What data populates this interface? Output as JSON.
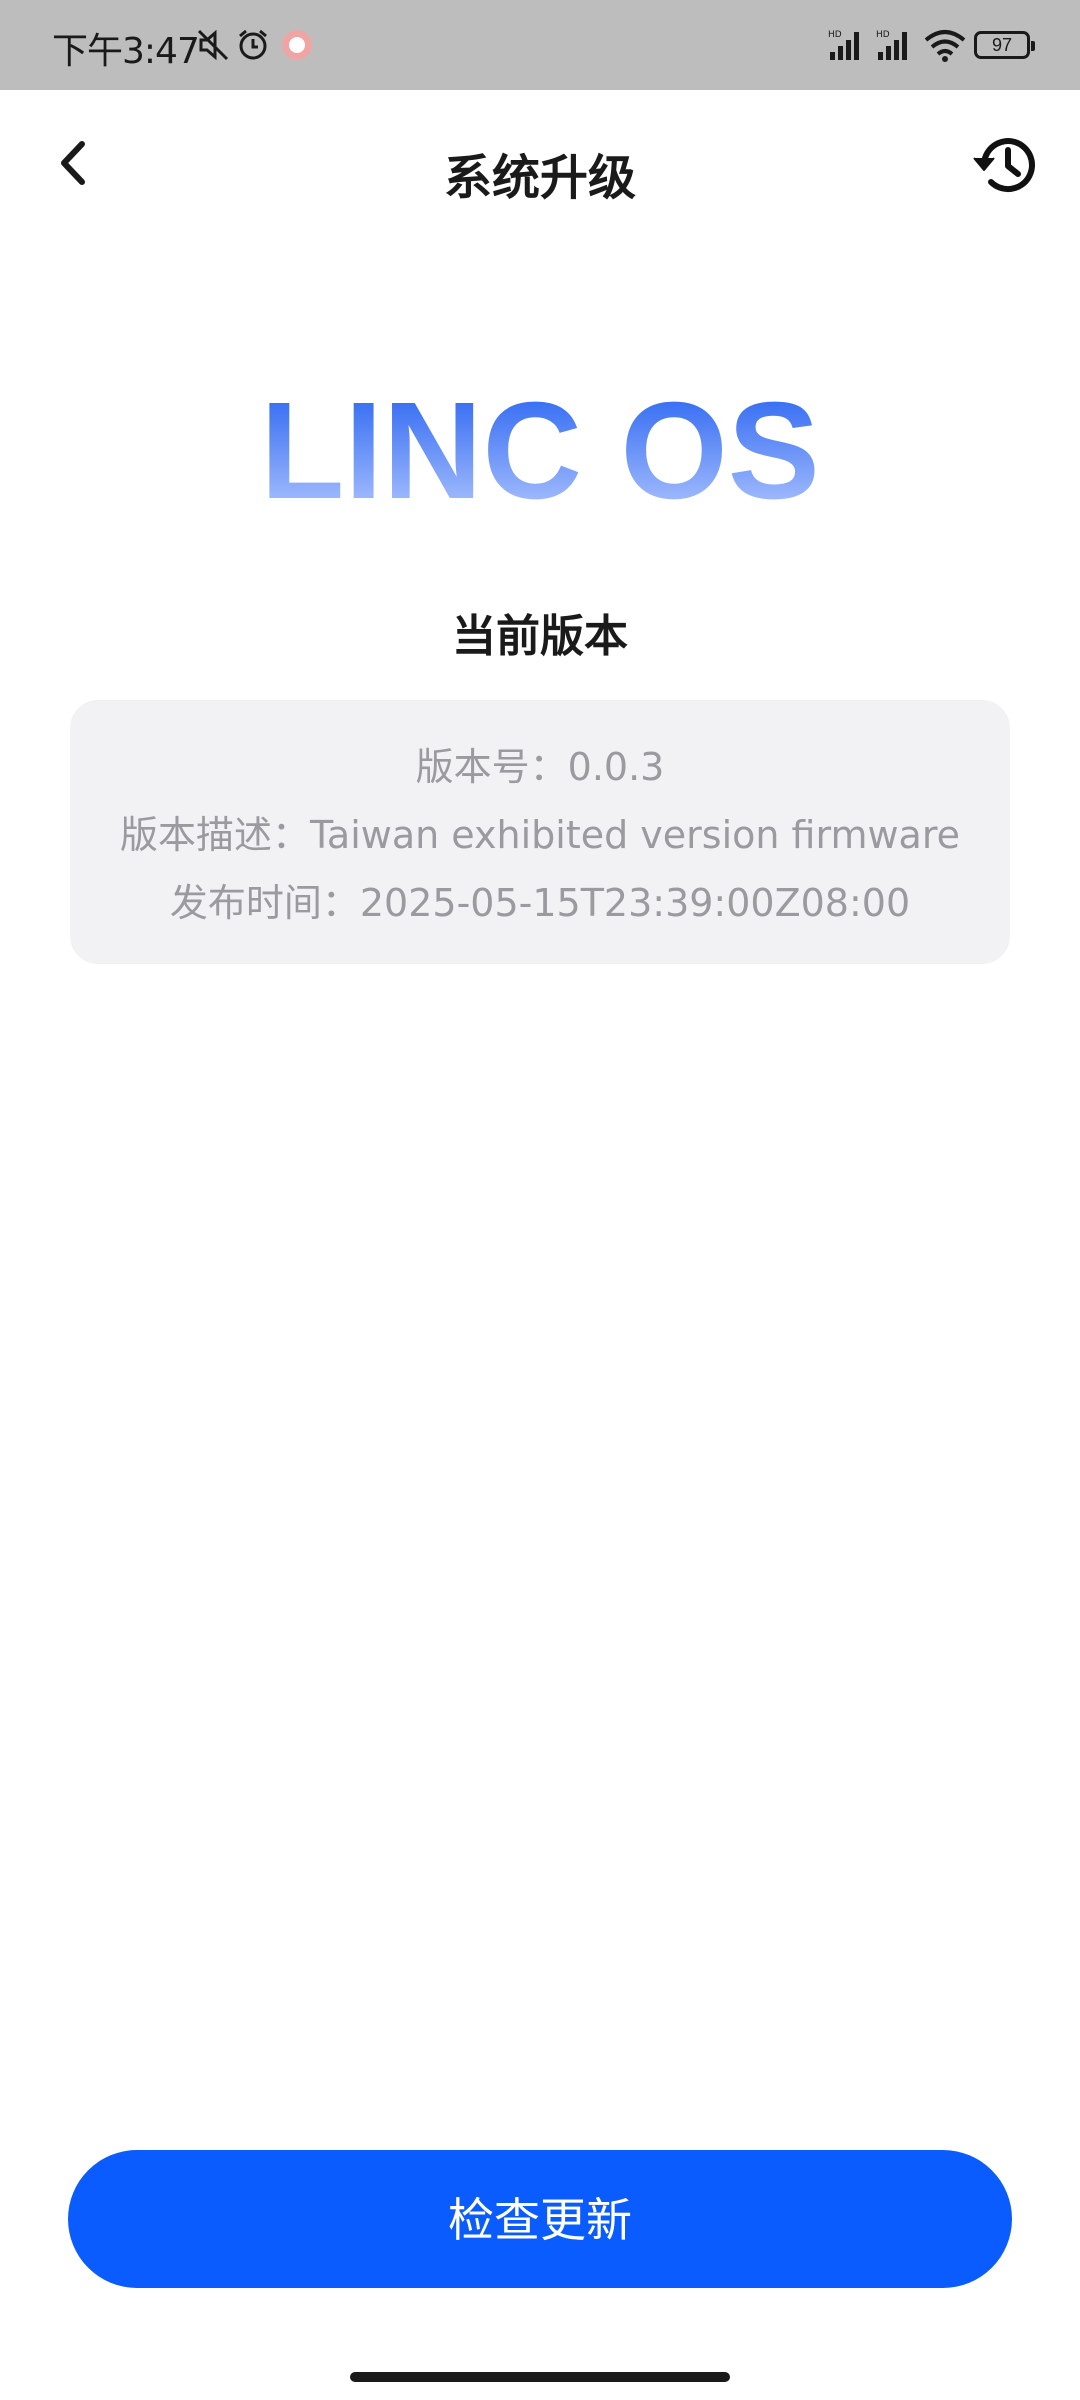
{
  "status_bar": {
    "time": "下午3:47",
    "battery": "97"
  },
  "header": {
    "title": "系统升级"
  },
  "logo": {
    "text": "LINC OS"
  },
  "current_version": {
    "heading": "当前版本",
    "version_line": "版本号：0.0.3",
    "description_line": "版本描述：Taiwan exhibited version firmware",
    "release_line": "发布时间：2025-05-15T23:39:00Z08:00"
  },
  "actions": {
    "check_update_label": "检查更新"
  },
  "colors": {
    "primary": "#0a5cff",
    "logo_gradient_top": "#1f5cf0",
    "logo_gradient_bottom": "#b8ccff"
  }
}
